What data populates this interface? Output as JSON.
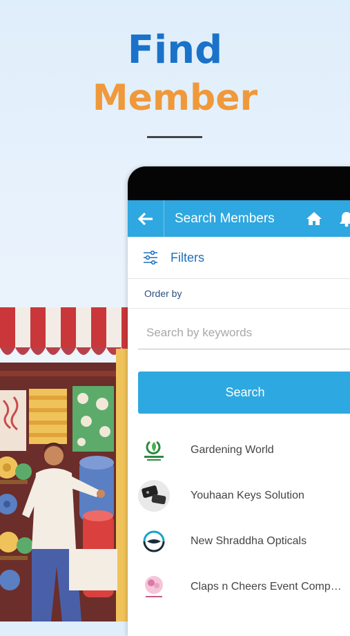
{
  "hero": {
    "line1": "Find",
    "line2": "Member"
  },
  "appbar": {
    "title": "Search Members"
  },
  "filters": {
    "label": "Filters"
  },
  "order_by": {
    "label": "Order by"
  },
  "search": {
    "placeholder": "Search by keywords",
    "value": "",
    "button_label": "Search"
  },
  "members": [
    {
      "name": "Gardening World",
      "icon": "gardening-world-logo"
    },
    {
      "name": "Youhaan Keys Solution",
      "icon": "youhaan-keys-logo"
    },
    {
      "name": "New Shraddha Opticals",
      "icon": "shraddha-opticals-logo"
    },
    {
      "name": "Claps n Cheers Event Comp…",
      "icon": "claps-n-cheers-logo"
    }
  ],
  "colors": {
    "primary_blue": "#2fa7e0",
    "title_blue": "#1a72c9",
    "title_orange": "#f0993a"
  }
}
